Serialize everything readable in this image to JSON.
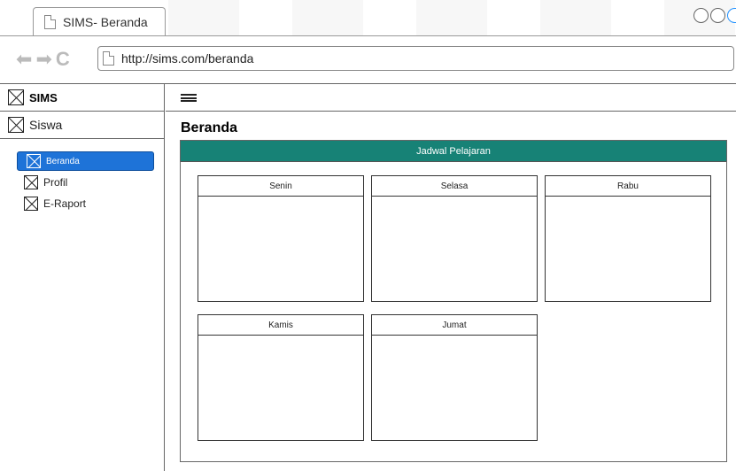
{
  "browser": {
    "tab_title": "SIMS- Beranda",
    "url": "http://sims.com/beranda"
  },
  "sidebar": {
    "brand": "SIMS",
    "user": "Siswa",
    "items": [
      {
        "label": "Beranda",
        "active": true
      },
      {
        "label": "Profil",
        "active": false
      },
      {
        "label": "E-Raport",
        "active": false
      }
    ]
  },
  "main": {
    "page_title": "Beranda",
    "panel_title": "Jadwal Pelajaran",
    "days": [
      "Senin",
      "Selasa",
      "Rabu",
      "Kamis",
      "Jumat"
    ]
  },
  "colors": {
    "panel_header": "#178276",
    "active_menu": "#1e73d8"
  }
}
